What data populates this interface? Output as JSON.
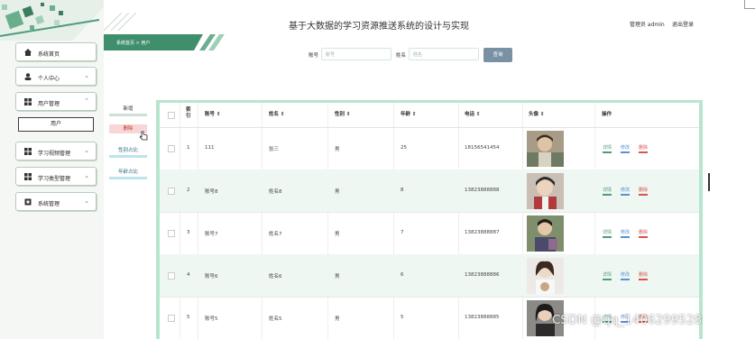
{
  "header": {
    "title": "基于大数据的学习资源推送系统的设计与实现",
    "admin_label": "管理员 admin",
    "logout_label": "退出登录",
    "breadcrumb": "系统首页 > 用户"
  },
  "sidebar": {
    "items": [
      {
        "label": "系统首页",
        "icon": "home-icon",
        "chevron": ""
      },
      {
        "label": "个人中心",
        "icon": "person-icon",
        "chevron": "⌄"
      },
      {
        "label": "用户管理",
        "icon": "grid-icon",
        "chevron": "⌃"
      },
      {
        "label": "学习视频管理",
        "icon": "grid-icon",
        "chevron": "⌄"
      },
      {
        "label": "学习类型管理",
        "icon": "grid-icon",
        "chevron": "⌄"
      },
      {
        "label": "系统管理",
        "icon": "settings-icon",
        "chevron": "⌄"
      }
    ],
    "subitem": "用户"
  },
  "search": {
    "account_label": "账号",
    "account_placeholder": "账号",
    "name_label": "姓名",
    "name_placeholder": "姓名",
    "button": "查询"
  },
  "actions": {
    "add": "新增",
    "delete": "删除",
    "gender_stats": "性别占比",
    "age_stats": "年龄占比"
  },
  "table": {
    "headers": [
      "索引",
      "账号 ⇕",
      "姓名 ⇕",
      "性别 ⇕",
      "年龄 ⇕",
      "电话 ⇕",
      "头像 ⇕",
      "操作"
    ],
    "rows": [
      {
        "index": "1",
        "account": "111",
        "name": "张三",
        "gender": "男",
        "age": "25",
        "phone": "18156541454"
      },
      {
        "index": "2",
        "account": "账号8",
        "name": "姓名8",
        "gender": "男",
        "age": "8",
        "phone": "13823888888"
      },
      {
        "index": "3",
        "account": "账号7",
        "name": "姓名7",
        "gender": "男",
        "age": "7",
        "phone": "13823888887"
      },
      {
        "index": "4",
        "account": "账号6",
        "name": "姓名6",
        "gender": "男",
        "age": "6",
        "phone": "13823888886"
      },
      {
        "index": "5",
        "account": "账号5",
        "name": "姓名5",
        "gender": "男",
        "age": "5",
        "phone": "13823888885"
      }
    ],
    "ops": {
      "detail": "详情",
      "edit": "修改",
      "delete": "删除"
    }
  },
  "watermark": "CSDN @qq_1406299528",
  "colors": {
    "accent_green": "#4f9c7c",
    "table_border": "#b7e6cf",
    "search_button": "#7891a3",
    "detail": "#4f9c7c",
    "edit": "#5b8fd6",
    "delete": "#d9534f"
  }
}
